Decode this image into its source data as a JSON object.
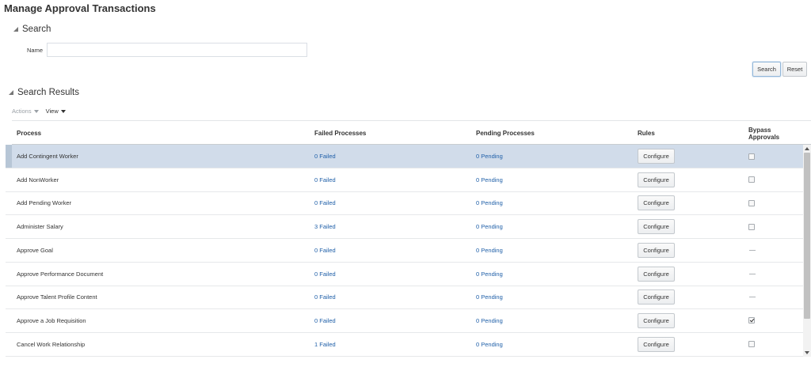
{
  "page_title": "Manage Approval Transactions",
  "search": {
    "header": "Search",
    "name_label": "Name",
    "name_value": "",
    "search_button": "Search",
    "reset_button": "Reset"
  },
  "results": {
    "header": "Search Results",
    "actions_label": "Actions",
    "view_label": "View",
    "columns": {
      "process": "Process",
      "failed": "Failed Processes",
      "pending": "Pending Processes",
      "rules": "Rules",
      "bypass_line1": "Bypass",
      "bypass_line2": "Approvals"
    },
    "rows": [
      {
        "process": "Add Contingent Worker",
        "failed": "0 Failed",
        "pending": "0 Pending",
        "rules": "Configure",
        "bypass": "unchecked",
        "selected": true
      },
      {
        "process": "Add NonWorker",
        "failed": "0 Failed",
        "pending": "0 Pending",
        "rules": "Configure",
        "bypass": "unchecked",
        "selected": false
      },
      {
        "process": "Add Pending Worker",
        "failed": "0 Failed",
        "pending": "0 Pending",
        "rules": "Configure",
        "bypass": "unchecked",
        "selected": false
      },
      {
        "process": "Administer Salary",
        "failed": "3 Failed",
        "pending": "0 Pending",
        "rules": "Configure",
        "bypass": "unchecked",
        "selected": false
      },
      {
        "process": "Approve Goal",
        "failed": "0 Failed",
        "pending": "0 Pending",
        "rules": "Configure",
        "bypass": "none",
        "selected": false
      },
      {
        "process": "Approve Performance Document",
        "failed": "0 Failed",
        "pending": "0 Pending",
        "rules": "Configure",
        "bypass": "none",
        "selected": false
      },
      {
        "process": "Approve Talent Profile Content",
        "failed": "0 Failed",
        "pending": "0 Pending",
        "rules": "Configure",
        "bypass": "none",
        "selected": false
      },
      {
        "process": "Approve a Job Requisition",
        "failed": "0 Failed",
        "pending": "0 Pending",
        "rules": "Configure",
        "bypass": "checked",
        "selected": false
      },
      {
        "process": "Cancel Work Relationship",
        "failed": "1 Failed",
        "pending": "0 Pending",
        "rules": "Configure",
        "bypass": "unchecked",
        "selected": false
      }
    ]
  },
  "colors": {
    "link": "#1f5fa8",
    "selected_row": "#d1dcea"
  },
  "icons": [
    "collapse-triangle-icon",
    "dropdown-caret-icon",
    "checkbox-icon",
    "scroll-up-icon",
    "scroll-down-icon"
  ]
}
